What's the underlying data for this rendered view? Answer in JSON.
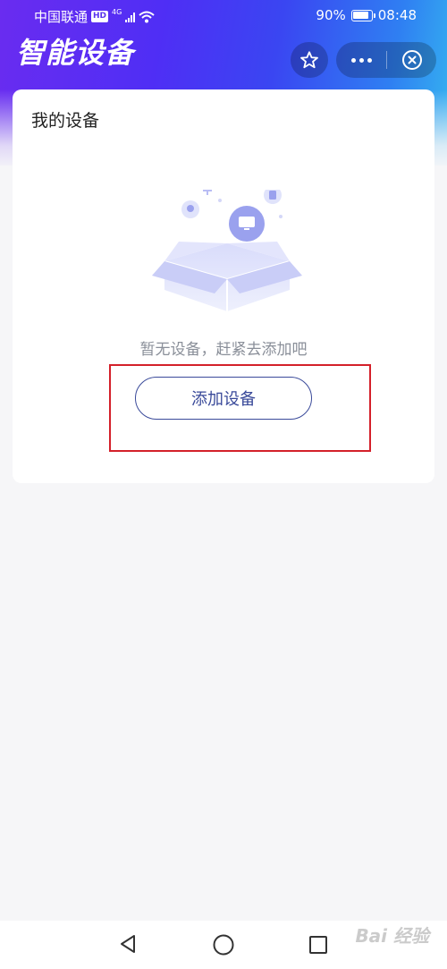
{
  "status_bar": {
    "carrier": "中国联通",
    "hd_badge": "HD",
    "network": "4G",
    "battery_percent": "90%",
    "time": "08:48",
    "battery_level": 0.9
  },
  "header": {
    "title": "智能设备",
    "favorite_icon": "star-icon",
    "more_icon": "more-dots-icon",
    "close_icon": "close-circle-icon"
  },
  "card": {
    "title": "我的设备",
    "empty_text": "暂无设备，赶紧去添加吧",
    "add_button_label": "添加设备"
  },
  "nav": {
    "back_icon": "back-triangle-icon",
    "home_icon": "home-circle-icon",
    "recent_icon": "recent-square-icon"
  },
  "watermark": "Bai 经验",
  "colors": {
    "accent": "#3a4a9a",
    "highlight": "#d4202a",
    "header_start": "#6a2cf0",
    "header_end": "#35b5f0"
  }
}
